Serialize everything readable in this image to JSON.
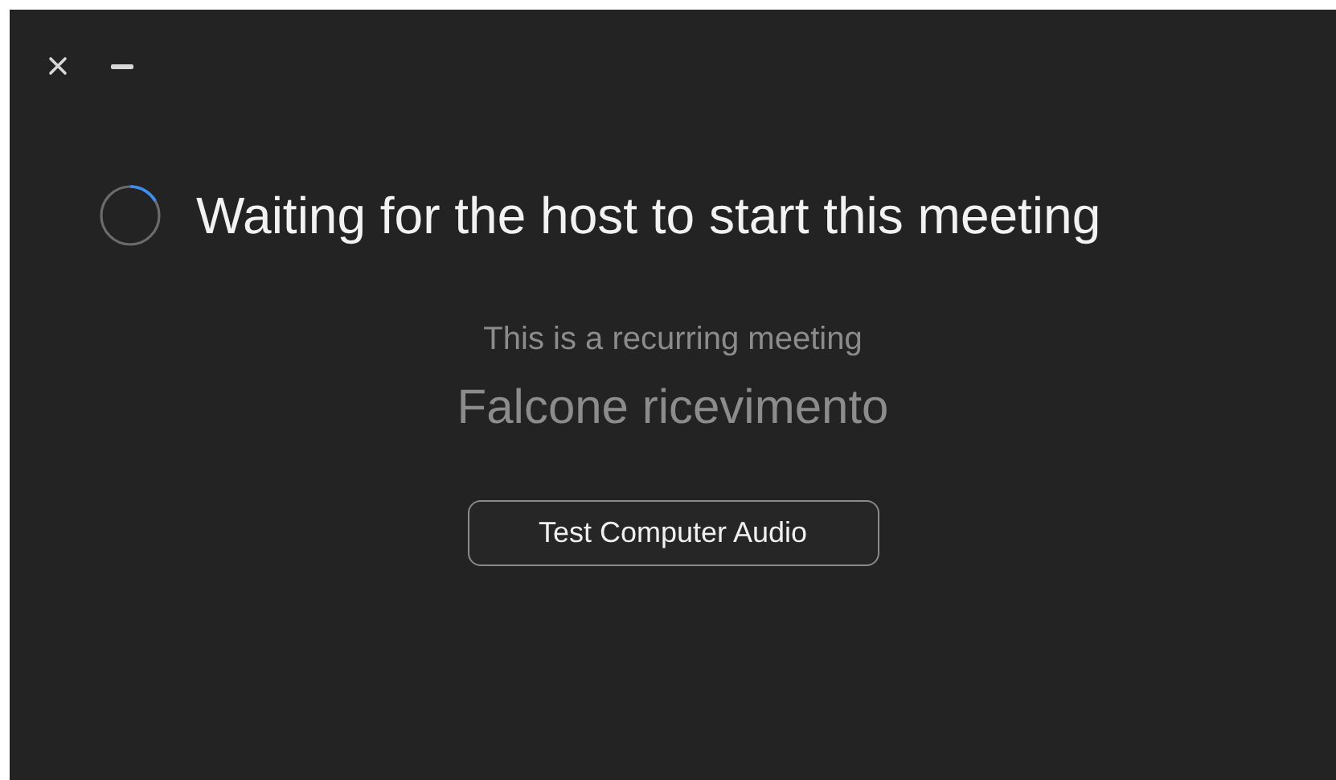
{
  "heading": "Waiting for the host to start this meeting",
  "subtitle": "This is a recurring meeting",
  "meeting_name": "Falcone ricevimento",
  "button": "Test Computer Audio"
}
